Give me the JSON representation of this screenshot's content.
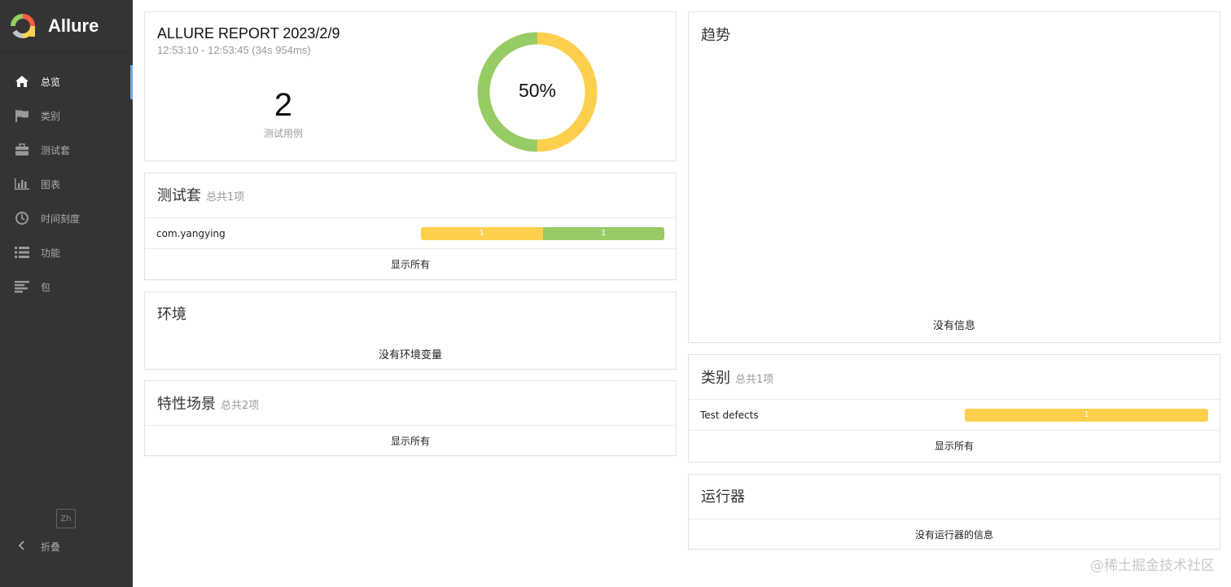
{
  "brand": {
    "name": "Allure"
  },
  "sidebar": {
    "items": [
      {
        "label": "总览",
        "icon": "home-icon",
        "active": true
      },
      {
        "label": "类别",
        "icon": "flag-icon",
        "active": false
      },
      {
        "label": "测试套",
        "icon": "briefcase-icon",
        "active": false
      },
      {
        "label": "图表",
        "icon": "bar-chart-icon",
        "active": false
      },
      {
        "label": "时间刻度",
        "icon": "clock-icon",
        "active": false
      },
      {
        "label": "功能",
        "icon": "list-icon",
        "active": false
      },
      {
        "label": "包",
        "icon": "align-left-icon",
        "active": false
      }
    ],
    "lang": "Zh",
    "collapse_label": "折叠"
  },
  "summary": {
    "title": "ALLURE REPORT 2023/2/9",
    "time_range": "12:53:10 - 12:53:45 (34s 954ms)",
    "count": "2",
    "count_label": "测试用例",
    "percent_label": "50%",
    "donut": [
      {
        "status": "broken",
        "fraction": 0.5,
        "color": "#fecf4c"
      },
      {
        "status": "passed",
        "fraction": 0.5,
        "color": "#97cc64"
      }
    ]
  },
  "suites": {
    "title": "测试套",
    "count_label": "总共1项",
    "rows": [
      {
        "name": "com.yangying",
        "segments": [
          {
            "value": "1",
            "color": "#fecf4c"
          },
          {
            "value": "1",
            "color": "#97cc64"
          }
        ]
      }
    ],
    "show_all": "显示所有"
  },
  "environment": {
    "title": "环境",
    "empty": "没有环境变量"
  },
  "features": {
    "title": "特性场景",
    "count_label": "总共2项",
    "show_all": "显示所有"
  },
  "trend": {
    "title": "趋势",
    "empty": "没有信息"
  },
  "categories": {
    "title": "类别",
    "count_label": "总共1项",
    "rows": [
      {
        "name": "Test defects",
        "segments": [
          {
            "value": "1",
            "color": "#fecf4c"
          }
        ]
      }
    ],
    "show_all": "显示所有"
  },
  "executors": {
    "title": "运行器",
    "empty": "没有运行器的信息"
  },
  "watermark": "@稀土掘金技术社区"
}
